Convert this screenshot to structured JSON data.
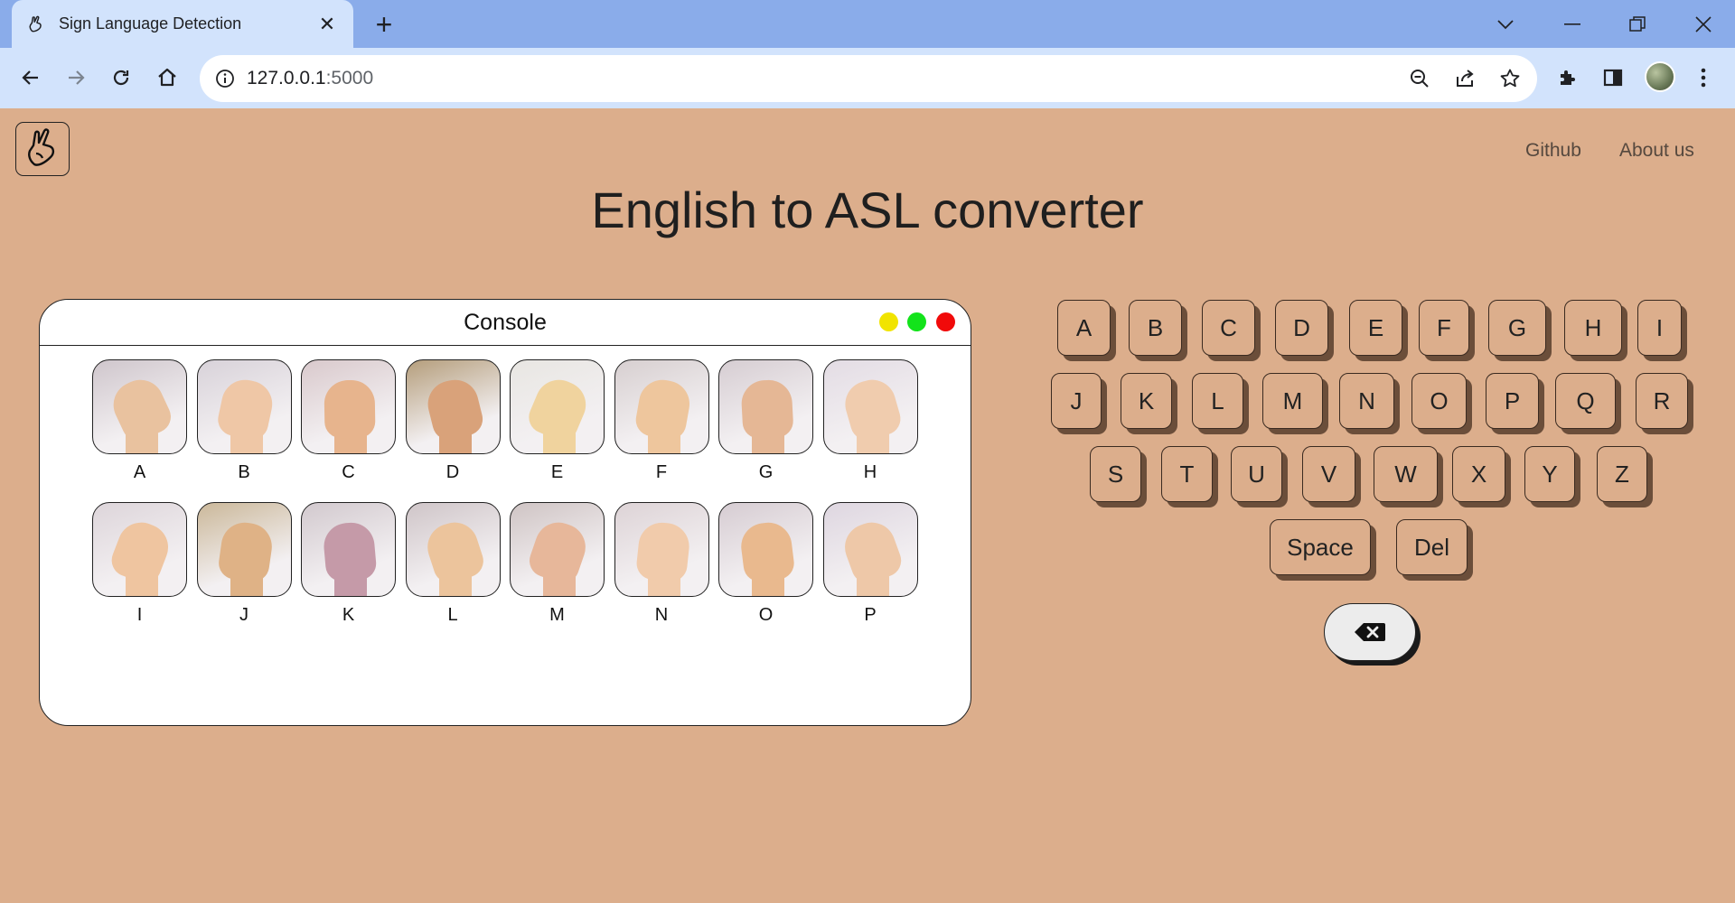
{
  "browser": {
    "tab_title": "Sign Language Detection",
    "url_host": "127.0.0.1",
    "url_port": ":5000"
  },
  "nav": {
    "github": "Github",
    "about": "About us"
  },
  "page_title": "English to ASL converter",
  "console": {
    "title": "Console",
    "dot_colors": [
      "#f1e400",
      "#13e31b",
      "#f10a0a"
    ],
    "cards": [
      {
        "letter": "A"
      },
      {
        "letter": "B"
      },
      {
        "letter": "C"
      },
      {
        "letter": "D"
      },
      {
        "letter": "E"
      },
      {
        "letter": "F"
      },
      {
        "letter": "G"
      },
      {
        "letter": "H"
      },
      {
        "letter": "I"
      },
      {
        "letter": "J"
      },
      {
        "letter": "K"
      },
      {
        "letter": "L"
      },
      {
        "letter": "M"
      },
      {
        "letter": "N"
      },
      {
        "letter": "O"
      },
      {
        "letter": "P"
      }
    ]
  },
  "keyboard": {
    "row1": [
      "A",
      "B",
      "C",
      "D",
      "E",
      "F",
      "G",
      "H",
      "I"
    ],
    "row2": [
      "J",
      "K",
      "L",
      "M",
      "N",
      "O",
      "P",
      "Q",
      "R"
    ],
    "row3": [
      "S",
      "T",
      "U",
      "V",
      "W",
      "X",
      "Y",
      "Z"
    ],
    "row4": [
      "Space",
      "Del"
    ],
    "backspace_icon": "backspace-icon"
  },
  "colors": {
    "page_bg": "#dcae8c",
    "key_shadow": "#6b4e3a"
  }
}
